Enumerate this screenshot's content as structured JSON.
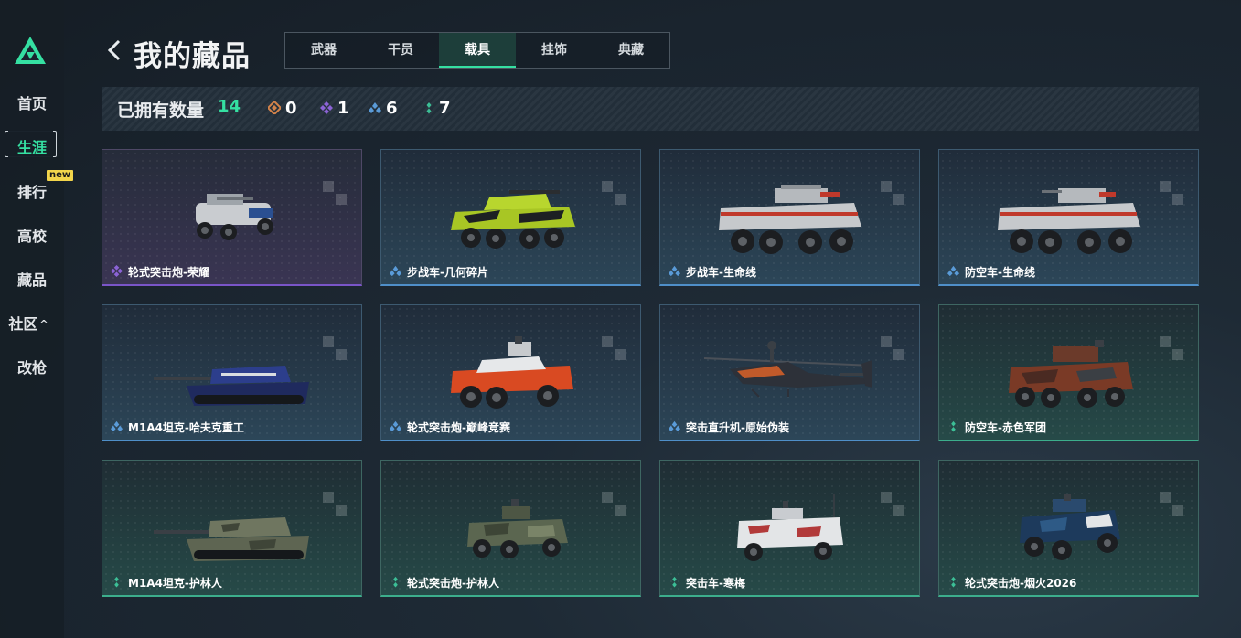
{
  "sidebar": {
    "items": [
      {
        "label": "首页"
      },
      {
        "label": "生涯"
      },
      {
        "label": "排行"
      },
      {
        "label": "高校"
      },
      {
        "label": "藏品"
      },
      {
        "label": "社区"
      },
      {
        "label": "改枪"
      }
    ],
    "new_badge": "new"
  },
  "header": {
    "title": "我的藏品",
    "tabs": [
      {
        "label": "武器"
      },
      {
        "label": "干员"
      },
      {
        "label": "载具"
      },
      {
        "label": "挂饰"
      },
      {
        "label": "典藏"
      }
    ],
    "active_tab": "载具"
  },
  "stats": {
    "label": "已拥有数量",
    "total": "14",
    "rarities": [
      {
        "rarity": "orange",
        "count": "0"
      },
      {
        "rarity": "purple",
        "count": "1"
      },
      {
        "rarity": "blue",
        "count": "6"
      },
      {
        "rarity": "green",
        "count": "7"
      }
    ]
  },
  "colors": {
    "accent": "#35e0a2",
    "orange": "#d4834a",
    "purple": "#8b63d6",
    "blue": "#5a9bd8",
    "green": "#3cbf96",
    "badge": "#f2d54b"
  },
  "vehicles": [
    {
      "name": "轮式突击炮-荣耀",
      "rarity": "purple"
    },
    {
      "name": "步战车-几何碎片",
      "rarity": "blue"
    },
    {
      "name": "步战车-生命线",
      "rarity": "blue"
    },
    {
      "name": "防空车-生命线",
      "rarity": "blue"
    },
    {
      "name": "M1A4坦克-哈夫克重工",
      "rarity": "blue"
    },
    {
      "name": "轮式突击炮-巅峰竞赛",
      "rarity": "blue"
    },
    {
      "name": "突击直升机-原始伪装",
      "rarity": "blue"
    },
    {
      "name": "防空车-赤色军团",
      "rarity": "green"
    },
    {
      "name": "M1A4坦克-护林人",
      "rarity": "green"
    },
    {
      "name": "轮式突击炮-护林人",
      "rarity": "green"
    },
    {
      "name": "突击车-寒梅",
      "rarity": "green"
    },
    {
      "name": "轮式突击炮-烟火2026",
      "rarity": "green"
    }
  ]
}
